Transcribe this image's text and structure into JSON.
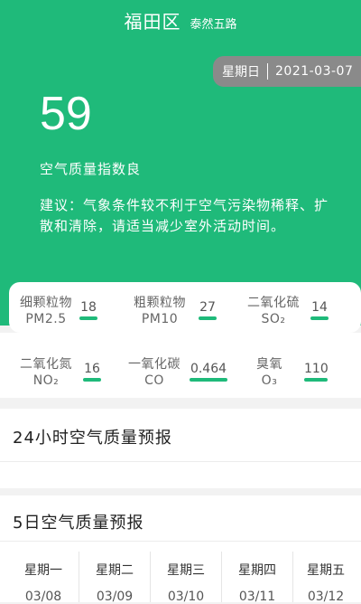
{
  "header": {
    "city": "福田区",
    "station": "泰然五路",
    "weekday": "星期日",
    "date": "2021-03-07"
  },
  "aqi": {
    "value": "59",
    "quality_text": "空气质量指数良",
    "advice_line1": "建议：气象条件较不利于空气污染物稀释、扩",
    "advice_line2": "散和清除，请适当减少室外活动时间。"
  },
  "pollutants": [
    {
      "name": "细颗粒物",
      "code": "PM2.5",
      "value": "18"
    },
    {
      "name": "粗颗粒物",
      "code": "PM10",
      "value": "27"
    },
    {
      "name": "二氧化硫",
      "code": "SO₂",
      "value": "14"
    },
    {
      "name": "二氧化氮",
      "code": "NO₂",
      "value": "16"
    },
    {
      "name": "一氧化碳",
      "code": "CO",
      "value": "0.464"
    },
    {
      "name": "臭氧",
      "code": "O₃",
      "value": "110"
    }
  ],
  "sections": {
    "hourly_title": "24小时空气质量预报",
    "daily_title": "5日空气质量预报"
  },
  "forecast": [
    {
      "weekday": "星期一",
      "date": "03/08"
    },
    {
      "weekday": "星期二",
      "date": "03/09"
    },
    {
      "weekday": "星期三",
      "date": "03/10"
    },
    {
      "weekday": "星期四",
      "date": "03/11"
    },
    {
      "weekday": "星期五",
      "date": "03/12"
    }
  ],
  "colors": {
    "accent": "#1fba7a",
    "pill": "#8a8a8a"
  }
}
